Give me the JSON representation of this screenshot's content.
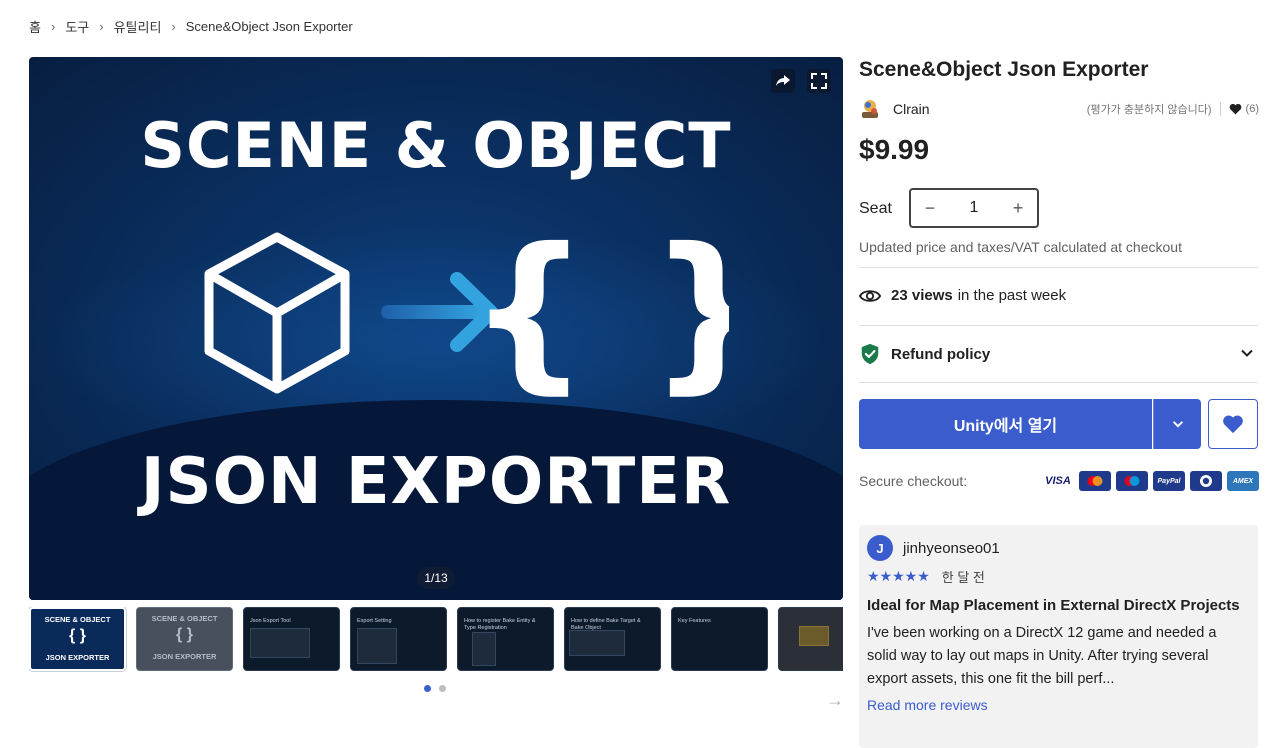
{
  "breadcrumb": {
    "items": [
      "홈",
      "도구",
      "유틸리티",
      "Scene&Object Json Exporter"
    ]
  },
  "hero": {
    "title_top": "SCENE & OBJECT",
    "title_bottom": "JSON EXPORTER",
    "counter": "1/13",
    "share_icon": "share-icon",
    "fullscreen_icon": "fullscreen-icon"
  },
  "thumbnails": [
    {
      "title": "SCENE & OBJECT",
      "subtitle": "JSON EXPORTER",
      "braces": "{ }"
    },
    {
      "title": "SCENE & OBJECT",
      "subtitle": "JSON EXPORTER",
      "braces": "{ }"
    },
    {
      "caption": "Json Export Tool"
    },
    {
      "caption": "Export Setting"
    },
    {
      "caption": "How to register Bake Entity & Type Registration"
    },
    {
      "caption": "How to define Bake Target & Bake Object"
    },
    {
      "caption": "Key Features"
    }
  ],
  "product": {
    "title": "Scene&Object Json Exporter",
    "author": "Clrain",
    "rating_text": "(평가가 충분하지 않습니다)",
    "favorites": "(6)",
    "price": "$9.99",
    "seat_label": "Seat",
    "seat_value": "1",
    "vat_note": "Updated price and taxes/VAT calculated at checkout",
    "views_count": "23 views",
    "views_suffix": "in the past week",
    "refund_label": "Refund policy",
    "buy_label": "Unity에서 열기",
    "secure_label": "Secure checkout:",
    "payment_methods": [
      "VISA",
      "Mastercard",
      "Maestro",
      "PayPal",
      "Diners",
      "AMEX"
    ]
  },
  "review": {
    "avatar_letter": "J",
    "user": "jinhyeonseo01",
    "stars": "★★★★★",
    "rating": 5,
    "time": "한 달 전",
    "title": "Ideal for Map Placement in External DirectX Projects",
    "body": "I've been working on a DirectX 12 game and needed a solid way to lay out maps in Unity. After trying several export assets, this one fit the bill perf...",
    "more": "Read more reviews"
  },
  "colors": {
    "accent": "#3a5ccc",
    "hero_bg": "#0a2f60",
    "refund_green": "#1b7a4a"
  }
}
